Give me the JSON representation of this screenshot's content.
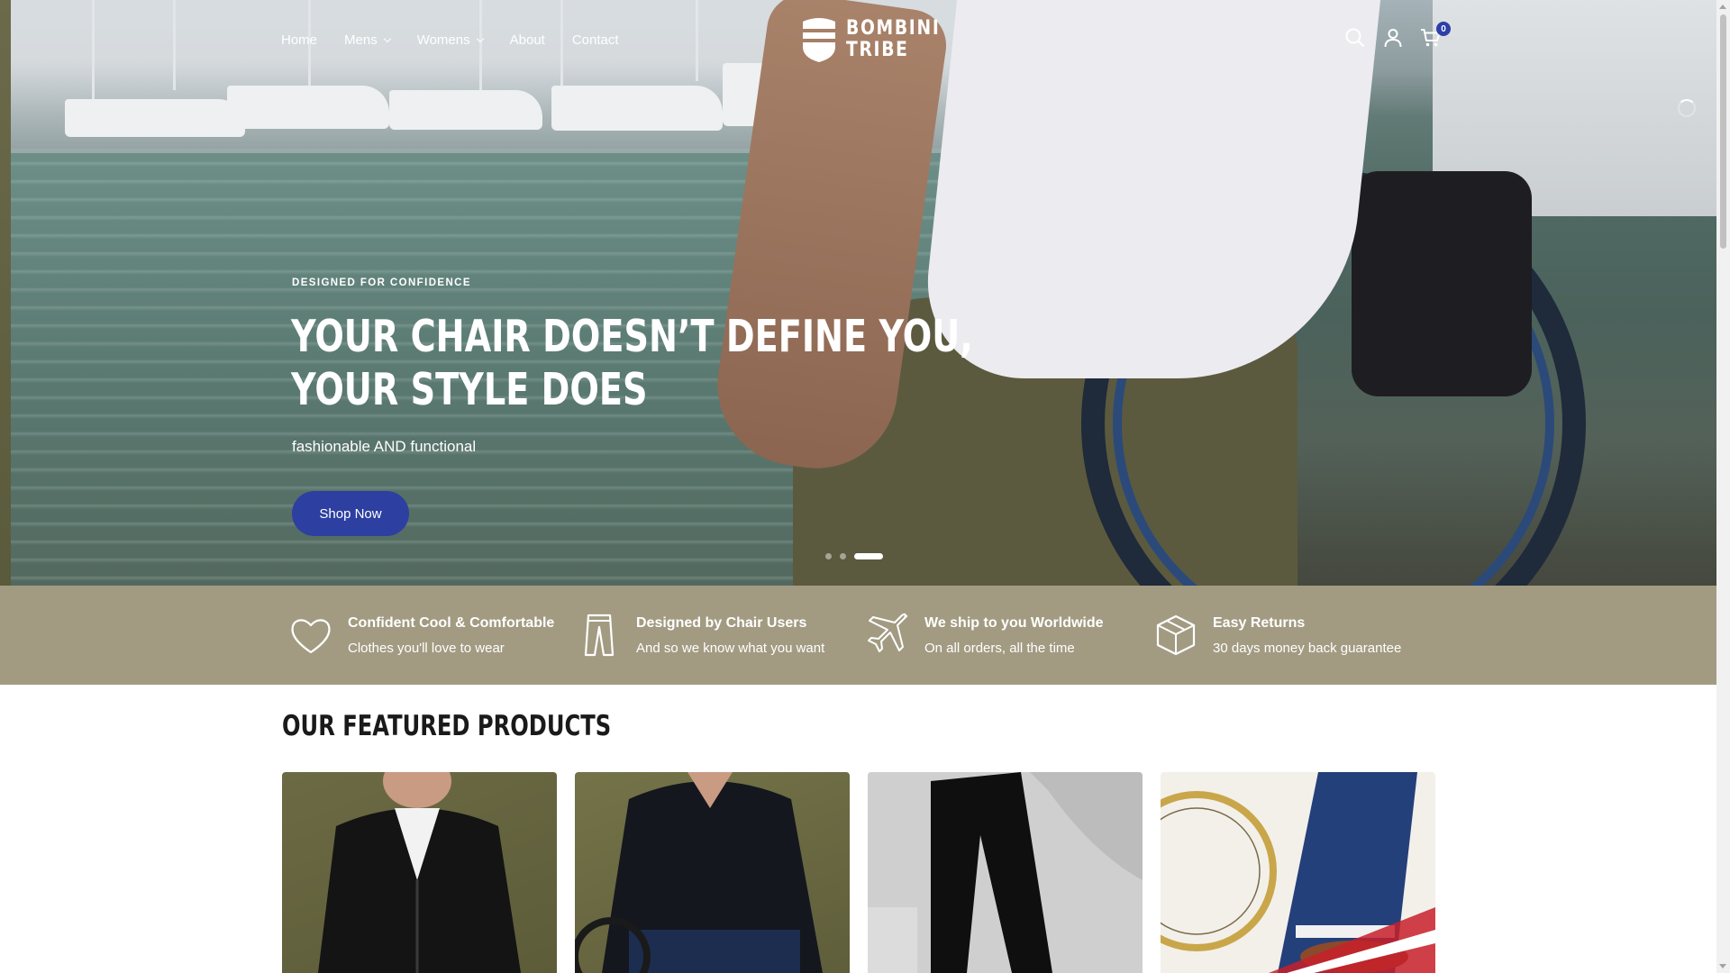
{
  "header": {
    "nav": [
      {
        "label": "Home",
        "dropdown": false
      },
      {
        "label": "Mens",
        "dropdown": true
      },
      {
        "label": "Womens",
        "dropdown": true
      },
      {
        "label": "About",
        "dropdown": false
      },
      {
        "label": "Contact",
        "dropdown": false
      }
    ],
    "logo": {
      "line1": "BOMBINI",
      "line2": "TRIBE"
    },
    "icons": [
      "search-icon",
      "account-icon",
      "cart-icon"
    ],
    "cart_count": "0"
  },
  "hero": {
    "eyebrow": "DESIGNED FOR CONFIDENCE",
    "headline_line1": "YOUR CHAIR DOESN’T DEFINE YOU,",
    "headline_line2": "YOUR STYLE DOES",
    "subline": "fashionable AND functional",
    "cta": "Shop Now",
    "slides": 3,
    "active_slide": 3
  },
  "features": [
    {
      "icon": "heart-icon",
      "title": "Confident Cool & Comfortable",
      "subtitle": "Clothes you'll love to wear"
    },
    {
      "icon": "trousers-icon",
      "title": "Designed by Chair Users",
      "subtitle": "And so we know what you want"
    },
    {
      "icon": "airplane-icon",
      "title": "We ship to you Worldwide",
      "subtitle": "On all orders, all the time"
    },
    {
      "icon": "box-icon",
      "title": "Easy Returns",
      "subtitle": "30 days money back guarantee"
    }
  ],
  "featured": {
    "title": "OUR FEATURED PRODUCTS"
  },
  "colors": {
    "accent": "#2d3fa0",
    "feature_bar": "#a29b82",
    "badge": "#2d3fa8"
  }
}
